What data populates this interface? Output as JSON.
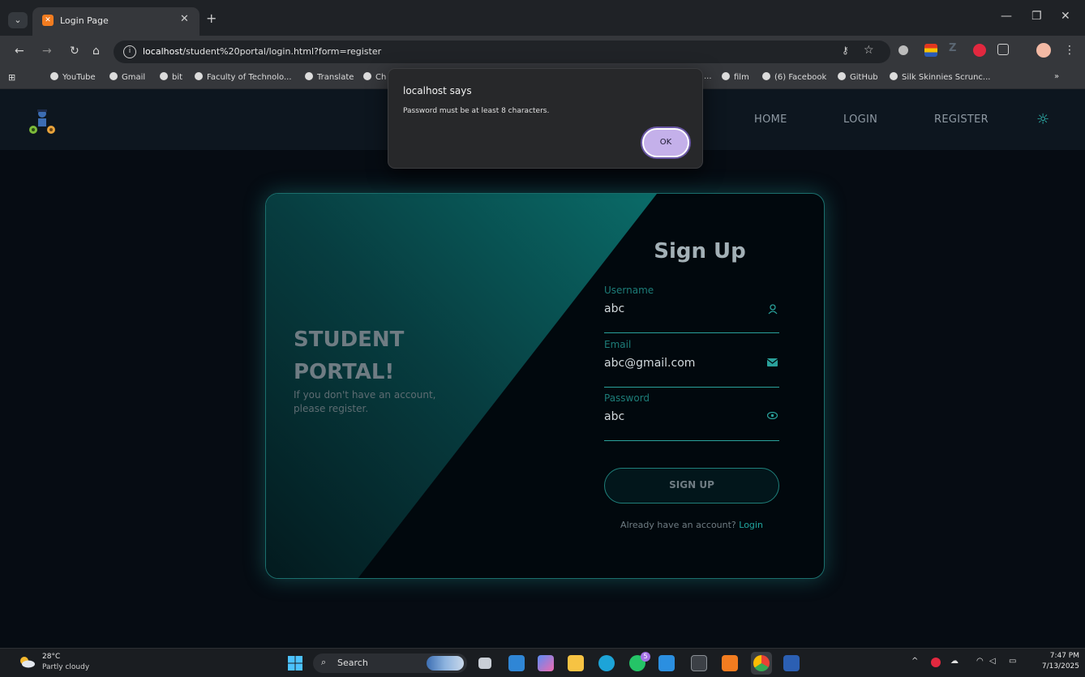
{
  "browser": {
    "tab_title": "Login Page",
    "new_tab": "+",
    "url_host": "localhost",
    "url_path": "/student%20portal/login.html?form=register",
    "bookmarks": [
      "YouTube",
      "Gmail",
      "bit",
      "Faculty of Technolo...",
      "Translate",
      "Ch",
      "...",
      "film",
      "(6) Facebook",
      "GitHub",
      "Silk Skinnies Scrunc..."
    ],
    "bookmarks_more": "»"
  },
  "site": {
    "nav": {
      "home": "HOME",
      "login": "LOGIN",
      "register": "REGISTER"
    },
    "brand": {
      "title": "STUDENT PORTAL!",
      "subtitle": "If you don't have an account, please register."
    },
    "form": {
      "title": "Sign Up",
      "username": {
        "label": "Username",
        "value": "abc"
      },
      "email": {
        "label": "Email",
        "value": "abc@gmail.com"
      },
      "password": {
        "label": "Password",
        "value": "abc"
      },
      "submit": "SIGN UP",
      "already_text": "Already have an account?",
      "login_link": "Login"
    }
  },
  "dialog": {
    "title": "localhost says",
    "message": "Password must be at least 8 characters.",
    "ok": "OK"
  },
  "taskbar": {
    "temperature": "28°C",
    "condition": "Partly cloudy",
    "search": "Search",
    "time": "7:47 PM",
    "date": "7/13/2025",
    "chat_badge": "5"
  },
  "colors": {
    "accent": "#2aa19b",
    "dialog_ok": "#c4b0ea"
  }
}
